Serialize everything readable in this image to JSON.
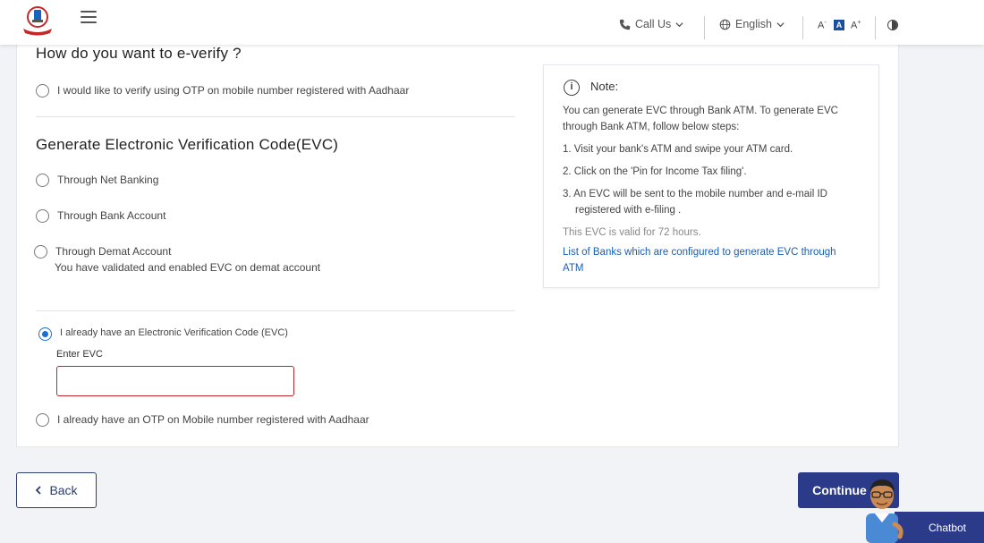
{
  "header": {
    "call_us": "Call Us",
    "language": "English",
    "font_decrease": "A",
    "font_normal": "A",
    "font_increase": "A"
  },
  "everify": {
    "title": "How do you want to e-verify ?",
    "option_otp_aadhaar": "I would like to verify using OTP on mobile number registered with Aadhaar"
  },
  "evc": {
    "title": "Generate Electronic Verification Code(EVC)",
    "net_banking": "Through Net Banking",
    "bank_account": "Through Bank Account",
    "demat_account": "Through Demat Account",
    "demat_note": "You have validated and enabled EVC on demat account",
    "already_have_evc": "I already have an Electronic Verification Code (EVC)",
    "enter_evc_label": "Enter EVC",
    "enter_evc_value": "",
    "already_have_otp": "I already have an OTP on Mobile number registered with Aadhaar",
    "selected": "already_have_evc"
  },
  "note": {
    "title": "Note:",
    "intro": "You can generate EVC through Bank ATM. To generate EVC through Bank ATM, follow below steps:",
    "step1": "1. Visit your bank's ATM and swipe your ATM card.",
    "step2": "2. Click on the 'Pin for Income Tax filing'.",
    "step3": "3. An EVC will be sent to the mobile number and e-mail ID",
    "step3b": "registered with e-filing .",
    "validity": "This EVC is valid for 72 hours.",
    "link": "List of Banks which are configured to generate EVC through ATM"
  },
  "footer": {
    "back": "Back",
    "continue": "Continue",
    "chatbot": "Chatbot"
  },
  "colors": {
    "primary": "#2c3a8a",
    "radio_selected": "#1a6fd4",
    "error_border": "#c0272d",
    "link": "#1a5fb4"
  }
}
